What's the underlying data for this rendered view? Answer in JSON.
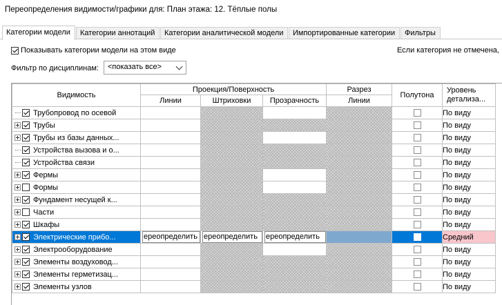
{
  "window": {
    "title": "Переопределения видимости/графики для: План этажа: 12. Тёплые полы"
  },
  "tabs": [
    {
      "label": "Категории модели",
      "active": true
    },
    {
      "label": "Категории аннотаций",
      "active": false
    },
    {
      "label": "Категории аналитической модели",
      "active": false
    },
    {
      "label": "Импортированные категории",
      "active": false
    },
    {
      "label": "Фильтры",
      "active": false
    }
  ],
  "options": {
    "show_categories_label": "Показывать категории модели на этом виде",
    "show_categories_checked": true,
    "note": "Если категория не отмечена,",
    "discipline_filter_label": "Фильтр по дисциплинам:",
    "discipline_filter_value": "<показать все>"
  },
  "grid": {
    "headers": {
      "visibility": "Видимость",
      "projection_group": "Проекция/Поверхность",
      "lines": "Линии",
      "patterns": "Штриховки",
      "transparency": "Прозрачность",
      "cut_group": "Разрез",
      "cut_lines": "Линии",
      "halftone": "Полутона",
      "detail_level": "Уровень детализа..."
    },
    "override_text": "ереопределить",
    "rows": [
      {
        "name": "Трубопровод по осевой",
        "expandable": false,
        "visible": true,
        "level": "По виду"
      },
      {
        "name": "Трубы",
        "expandable": true,
        "visible": true,
        "level": "По виду"
      },
      {
        "name": "Трубы из базы данных...",
        "expandable": true,
        "visible": true,
        "level": "По виду"
      },
      {
        "name": "Устройства вызова и о...",
        "expandable": false,
        "visible": true,
        "level": "По виду"
      },
      {
        "name": "Устройства связи",
        "expandable": false,
        "visible": true,
        "level": "По виду"
      },
      {
        "name": "Фермы",
        "expandable": true,
        "visible": true,
        "level": "По виду"
      },
      {
        "name": "Формы",
        "expandable": true,
        "visible": false,
        "level": "По виду"
      },
      {
        "name": "Фундамент несущей к...",
        "expandable": true,
        "visible": true,
        "level": "По виду"
      },
      {
        "name": "Части",
        "expandable": true,
        "visible": false,
        "level": "По виду"
      },
      {
        "name": "Шкафы",
        "expandable": true,
        "visible": true,
        "level": "По виду"
      },
      {
        "name": "Электрические прибо...",
        "expandable": true,
        "visible": true,
        "level": "Средний",
        "selected": true
      },
      {
        "name": "Электрооборудование",
        "expandable": true,
        "visible": true,
        "level": "По виду"
      },
      {
        "name": "Элементы воздуховод...",
        "expandable": true,
        "visible": true,
        "level": "По виду"
      },
      {
        "name": "Элементы герметизац...",
        "expandable": true,
        "visible": true,
        "level": "По виду"
      },
      {
        "name": "Элементы узлов",
        "expandable": true,
        "visible": true,
        "level": "По виду"
      }
    ]
  }
}
